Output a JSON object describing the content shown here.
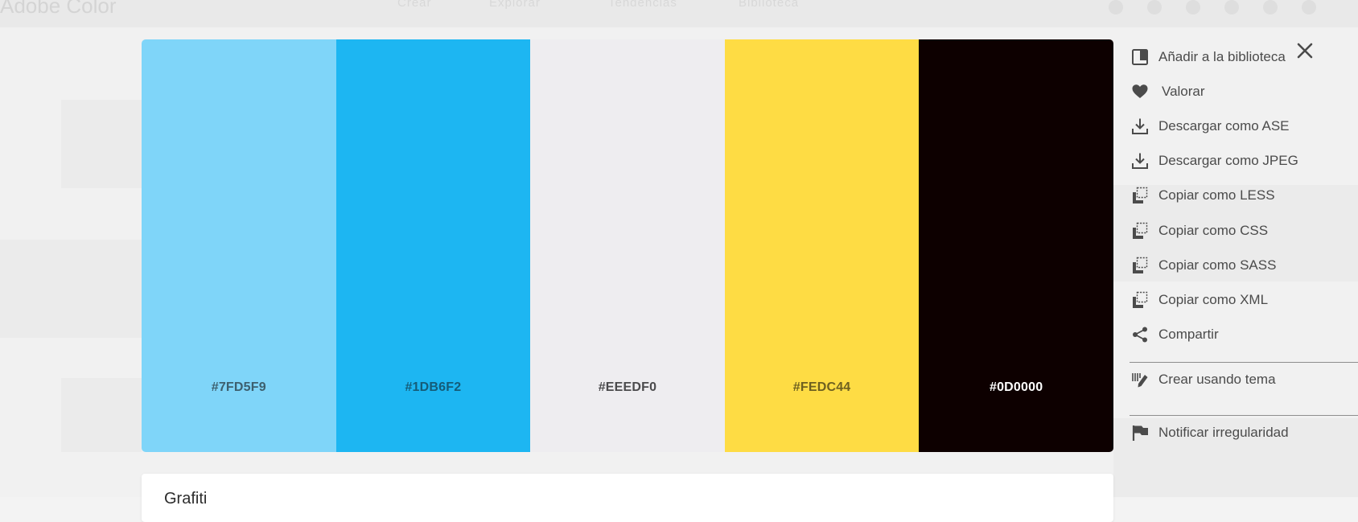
{
  "background": {
    "brand": "Adobe Color",
    "nav": [
      "Crear",
      "Explorar",
      "Tendencias",
      "Biblioteca"
    ]
  },
  "palette": {
    "swatches": [
      {
        "hex": "#7FD5F9",
        "color": "#7FD5F9",
        "text_color": "#3d5f6e"
      },
      {
        "hex": "#1DB6F2",
        "color": "#1DB6F2",
        "text_color": "#155c78"
      },
      {
        "hex": "#EEEDF0",
        "color": "#EEEDF0",
        "text_color": "#4a4a4c"
      },
      {
        "hex": "#FEDC44",
        "color": "#FEDC44",
        "text_color": "#6e6020"
      },
      {
        "hex": "#0D0000",
        "color": "#0D0000",
        "text_color": "#ffffff"
      }
    ]
  },
  "details_card": {
    "title": "Grafiti"
  },
  "actions": {
    "close_icon": "close-icon",
    "items": [
      {
        "id": "add-to-library",
        "label": "Añadir a la biblioteca",
        "icon": "library-icon"
      },
      {
        "id": "rate",
        "label": "Valorar",
        "icon": "heart-icon"
      },
      {
        "id": "download-ase",
        "label": "Descargar como ASE",
        "icon": "download-icon"
      },
      {
        "id": "download-jpeg",
        "label": "Descargar como JPEG",
        "icon": "download-icon"
      },
      {
        "id": "copy-less",
        "label": "Copiar como LESS",
        "icon": "copy-icon"
      },
      {
        "id": "copy-css",
        "label": "Copiar como CSS",
        "icon": "copy-icon"
      },
      {
        "id": "copy-sass",
        "label": "Copiar como SASS",
        "icon": "copy-icon"
      },
      {
        "id": "copy-xml",
        "label": "Copiar como XML",
        "icon": "copy-icon"
      },
      {
        "id": "share",
        "label": "Compartir",
        "icon": "share-icon"
      },
      {
        "id": "create-from-theme",
        "label": "Crear usando tema",
        "icon": "edit-icon"
      },
      {
        "id": "report",
        "label": "Notificar irregularidad",
        "icon": "flag-icon"
      }
    ]
  },
  "colors": {
    "menu_text": "#4b4b4b",
    "icon": "#4b4b4b",
    "divider": "#8e8e8e"
  }
}
